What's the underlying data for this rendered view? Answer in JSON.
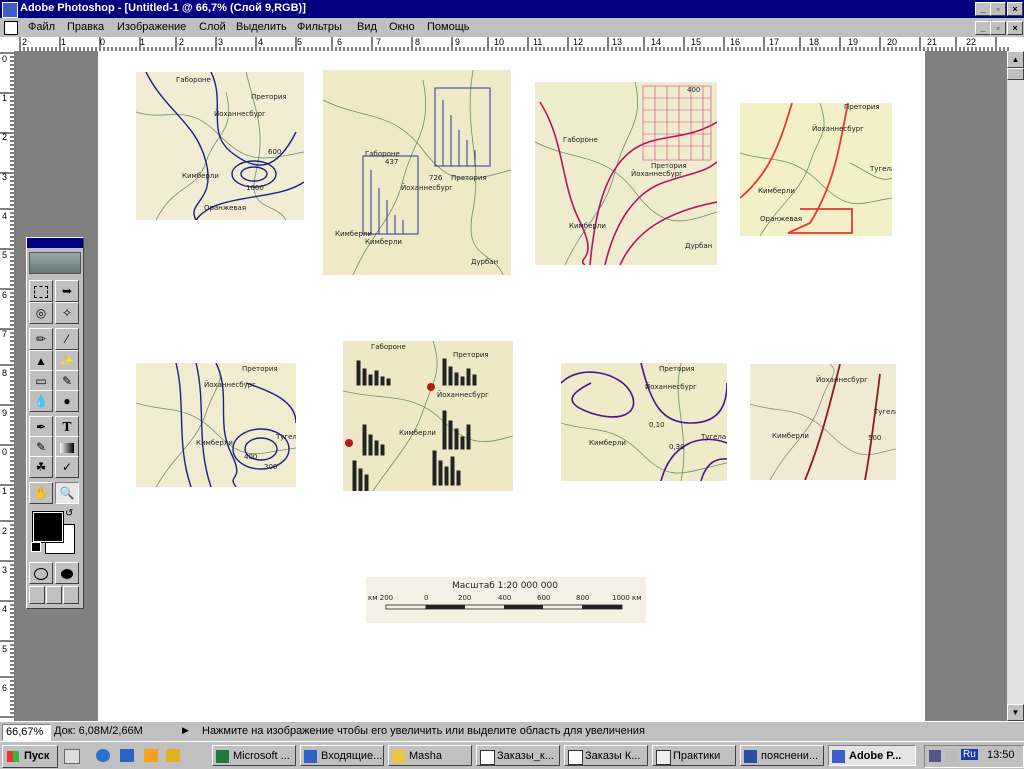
{
  "window": {
    "title": "Adobe Photoshop - [Untitled-1 @ 66,7% (Слой 9,RGB)]",
    "controls": {
      "minimize": "_",
      "restore": "▫",
      "close": "×"
    }
  },
  "menu": [
    "Файл",
    "Правка",
    "Изображение",
    "Слой",
    "Выделить",
    "Фильтры",
    "Вид",
    "Окно",
    "Помощь"
  ],
  "ruler_h": [
    "2",
    "1",
    "0",
    "1",
    "2",
    "3",
    "4",
    "5",
    "6",
    "7",
    "8",
    "9",
    "10",
    "11",
    "12",
    "13",
    "14",
    "15",
    "16",
    "17",
    "18",
    "19",
    "20",
    "21",
    "22"
  ],
  "ruler_v": [
    "0",
    "1",
    "2",
    "3",
    "4",
    "5",
    "6",
    "7",
    "8",
    "9",
    "0",
    "1",
    "2",
    "3",
    "4",
    "5",
    "6"
  ],
  "maps": {
    "m1": {
      "l1": "Габороне",
      "l2": "Претория",
      "l3": "Йоханнесбург",
      "l4": "Кимберли",
      "l5": "600",
      "l6": "1000",
      "l7": "Оранжевая"
    },
    "m2": {
      "l1": "Габороне",
      "l2": "437",
      "l3": "726",
      "l4": "Претория",
      "l5": "Йоханнесбург",
      "l6": "Кимберли",
      "l7": "Кимберли",
      "l8": "Дурбан"
    },
    "m3": {
      "l1": "400",
      "l2": "Габороне",
      "l3": "Претория",
      "l4": "Йоханнесбург",
      "l5": "Кимберли",
      "l6": "Дурбан"
    },
    "m4": {
      "l1": "Претория",
      "l2": "Йоханнесбург",
      "l3": "Кимберли",
      "l4": "Тугела",
      "l5": "Оранжевая"
    },
    "m5": {
      "l1": "Претория",
      "l2": "Йоханнесбург",
      "l3": "Кимберли",
      "l4": "400",
      "l5": "300",
      "l6": "Тугела"
    },
    "m6": {
      "l1": "Габороне",
      "l2": "Претория",
      "l3": "Йоханнесбург",
      "l4": "Кимберли"
    },
    "m7": {
      "l1": "Претория",
      "l2": "Йоханнесбург",
      "l3": "0,10",
      "l4": "0,30",
      "l5": "Кимберли",
      "l6": "Тугела"
    },
    "m8": {
      "l1": "Йоханнесбург",
      "l2": "Кимберли",
      "l3": "500",
      "l4": "Тугела"
    }
  },
  "scale": {
    "title": "Масштаб 1:20 000 000",
    "ticks": [
      "км 200",
      "0",
      "200",
      "400",
      "600",
      "800",
      "1000 км"
    ]
  },
  "status": {
    "zoom": "66,67%",
    "doc": "Док: 6,08М/2,66М",
    "hint": "Нажмите на изображение чтобы его увеличить или выделите область для увеличения"
  },
  "taskbar": {
    "start": "Пуск",
    "tasks": [
      "Microsoft ...",
      "Входящие...",
      "Masha",
      "Заказы_к...",
      "Заказы К...",
      "Практики",
      "пояснени...",
      "Adobe P..."
    ],
    "lang": "Ru",
    "clock": "13:50"
  },
  "toolbox": {
    "tools": [
      "marquee-icon",
      "move-icon",
      "lasso-icon",
      "magic-wand-icon",
      "airbrush-icon",
      "paintbrush-icon",
      "rubber-stamp-icon",
      "history-brush-icon",
      "eraser-icon",
      "pencil-icon",
      "blur-icon",
      "dodge-icon",
      "pen-icon",
      "type-icon",
      "measure-icon",
      "gradient-icon",
      "paint-bucket-icon",
      "eyedropper-icon",
      "hand-icon",
      "zoom-icon"
    ],
    "type_glyph": "T",
    "foreground": "#000000",
    "background": "#ffffff"
  }
}
